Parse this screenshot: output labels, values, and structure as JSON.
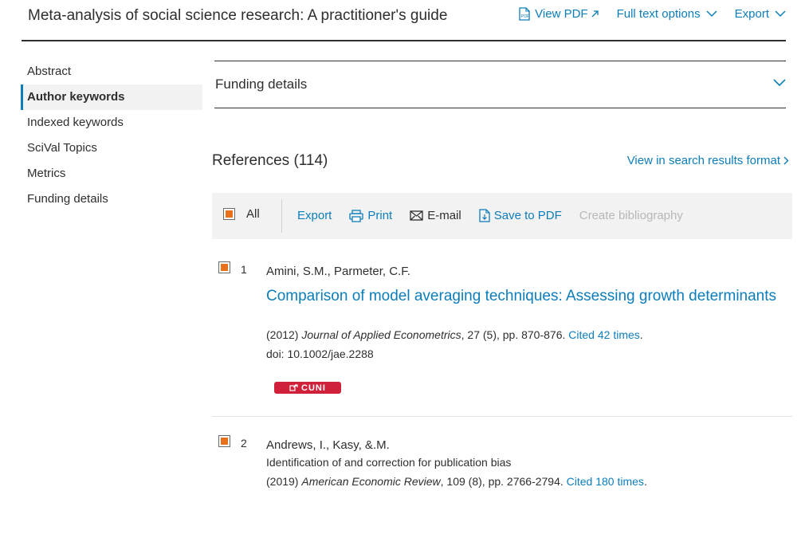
{
  "header": {
    "title": "Meta-analysis of social science research: A practitioner's guide",
    "view_pdf": "View PDF",
    "full_text_options": "Full text options",
    "export": "Export"
  },
  "sidebar": {
    "items": [
      {
        "label": "Abstract"
      },
      {
        "label": "Author keywords"
      },
      {
        "label": "Indexed keywords"
      },
      {
        "label": "SciVal Topics"
      },
      {
        "label": "Metrics"
      },
      {
        "label": "Funding details"
      }
    ],
    "active": "Author keywords"
  },
  "funding": {
    "label": "Funding details"
  },
  "references": {
    "title": "References (114)",
    "view_search": "View in search results format",
    "toolbar": {
      "all": "All",
      "export": "Export",
      "print": "Print",
      "email": "E-mail",
      "save_pdf": "Save to PDF",
      "create_bib": "Create bibliography"
    },
    "items": [
      {
        "num": "1",
        "authors": "Amini, S.M., Parmeter, C.F.",
        "title": "Comparison of model averaging techniques: Assessing growth determinants",
        "year": "(2012)",
        "journal": "Journal of Applied Econometrics",
        "details": ", 27 (5), pp. 870-876.",
        "cited": "Cited 42 times",
        "doi": "doi: 10.1002/jae.2288",
        "badge": "CUNI"
      },
      {
        "num": "2",
        "authors": "Andrews, I., Kasy, &.M.",
        "title": "Identification of and correction for publication bias",
        "year": "(2019)",
        "journal": "American Economic Review",
        "details": ", 109 (8), pp. 2766-2794.",
        "cited": "Cited 180 times"
      }
    ]
  },
  "colors": {
    "accent": "#0c7dbb",
    "checkbox": "#e9711c",
    "badge": "#d0203a"
  }
}
